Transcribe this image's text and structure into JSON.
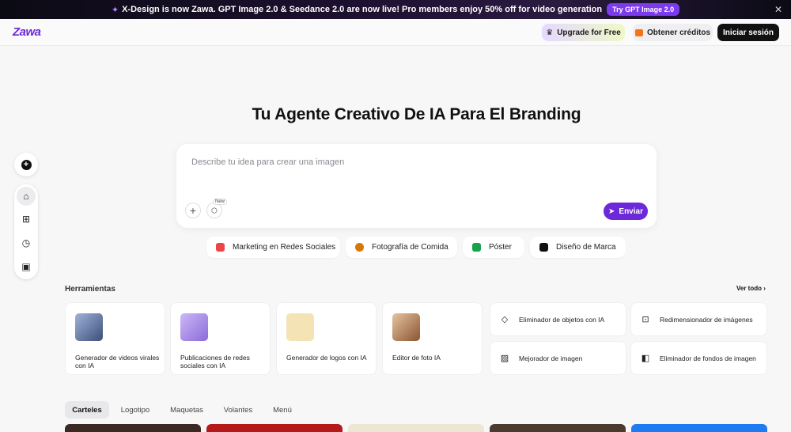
{
  "banner": {
    "text": "X-Design is now Zawa. GPT Image 2.0 & Seedance 2.0 are now live! Pro members enjoy 50% off for video generation",
    "cta": "Try GPT Image 2.0",
    "close": "✕"
  },
  "header": {
    "logo": "Zawa",
    "upgrade": "Upgrade for Free",
    "credits": "Obtener créditos",
    "login": "Iniciar sesión"
  },
  "hero": {
    "title": "Tu Agente Creativo De IA Para El Branding",
    "placeholder": "Describe tu idea para crear una imagen",
    "new_badge": "New",
    "send": "Enviar"
  },
  "chips": [
    {
      "label": "Marketing en Redes Sociales",
      "color": "#ef4444"
    },
    {
      "label": "Fotografía de Comida",
      "color": "#d97706"
    },
    {
      "label": "Póster",
      "color": "#16a34a"
    },
    {
      "label": "Diseño de Marca",
      "color": "#111111"
    }
  ],
  "tools": {
    "title": "Herramientas",
    "see_all": "Ver todo",
    "cards": [
      {
        "label": "Generador de videos virales con IA",
        "color": "#7a8fb8"
      },
      {
        "label": "Publicaciones de redes sociales con IA",
        "color": "#b49cf0"
      },
      {
        "label": "Generador de logos con IA",
        "color": "#f3e3b5"
      },
      {
        "label": "Editor de foto IA",
        "color": "#c8875a"
      }
    ],
    "rows": [
      {
        "label": "Eliminador de objetos con IA",
        "icon": "eraser-icon"
      },
      {
        "label": "Redimensionador de imágenes",
        "icon": "crop-icon"
      },
      {
        "label": "Mejorador de imagen",
        "icon": "image-enhance-icon"
      },
      {
        "label": "Eliminador de fondos de imagen",
        "icon": "background-remove-icon"
      }
    ]
  },
  "tabs": [
    "Carteles",
    "Logotipo",
    "Maquetas",
    "Volantes",
    "Menú"
  ],
  "gallery_colors": [
    "#3a2a22",
    "#b51a1a",
    "#ece6d2",
    "#4a3a30",
    "#1e7bf0"
  ]
}
